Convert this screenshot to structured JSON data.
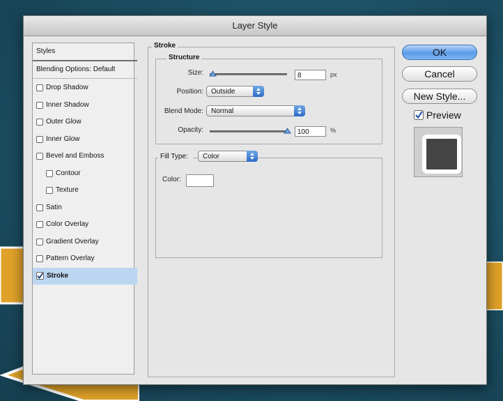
{
  "dialog": {
    "title": "Layer Style"
  },
  "styles_list": {
    "header": "Styles",
    "blending": "Blending Options: Default",
    "items": [
      {
        "label": "Drop Shadow",
        "checked": false,
        "indent": 0
      },
      {
        "label": "Inner Shadow",
        "checked": false,
        "indent": 0
      },
      {
        "label": "Outer Glow",
        "checked": false,
        "indent": 0
      },
      {
        "label": "Inner Glow",
        "checked": false,
        "indent": 0
      },
      {
        "label": "Bevel and Emboss",
        "checked": false,
        "indent": 0
      },
      {
        "label": "Contour",
        "checked": false,
        "indent": 1
      },
      {
        "label": "Texture",
        "checked": false,
        "indent": 1
      },
      {
        "label": "Satin",
        "checked": false,
        "indent": 0
      },
      {
        "label": "Color Overlay",
        "checked": false,
        "indent": 0
      },
      {
        "label": "Gradient Overlay",
        "checked": false,
        "indent": 0
      },
      {
        "label": "Pattern Overlay",
        "checked": false,
        "indent": 0
      },
      {
        "label": "Stroke",
        "checked": true,
        "indent": 0,
        "selected": true
      }
    ]
  },
  "stroke": {
    "title": "Stroke",
    "structure": {
      "title": "Structure",
      "size_label": "Size:",
      "size_value": "8",
      "size_unit": "px",
      "size_slider_fraction": 0.04,
      "position_label": "Position:",
      "position_value": "Outside",
      "blend_label": "Blend Mode:",
      "blend_value": "Normal",
      "opacity_label": "Opacity:",
      "opacity_value": "100",
      "opacity_unit": "%",
      "opacity_slider_fraction": 1.0
    },
    "fill": {
      "type_label": "Fill Type:",
      "type_value": "Color",
      "color_label": "Color:",
      "color_value": "#ffffff"
    }
  },
  "buttons": {
    "ok": "OK",
    "cancel": "Cancel",
    "new_style": "New Style..."
  },
  "preview": {
    "label": "Preview",
    "checked": true
  },
  "colors": {
    "accent": "#5c9be8",
    "selected_row": "#bcd5f1",
    "arrow": "#e0a22a"
  }
}
